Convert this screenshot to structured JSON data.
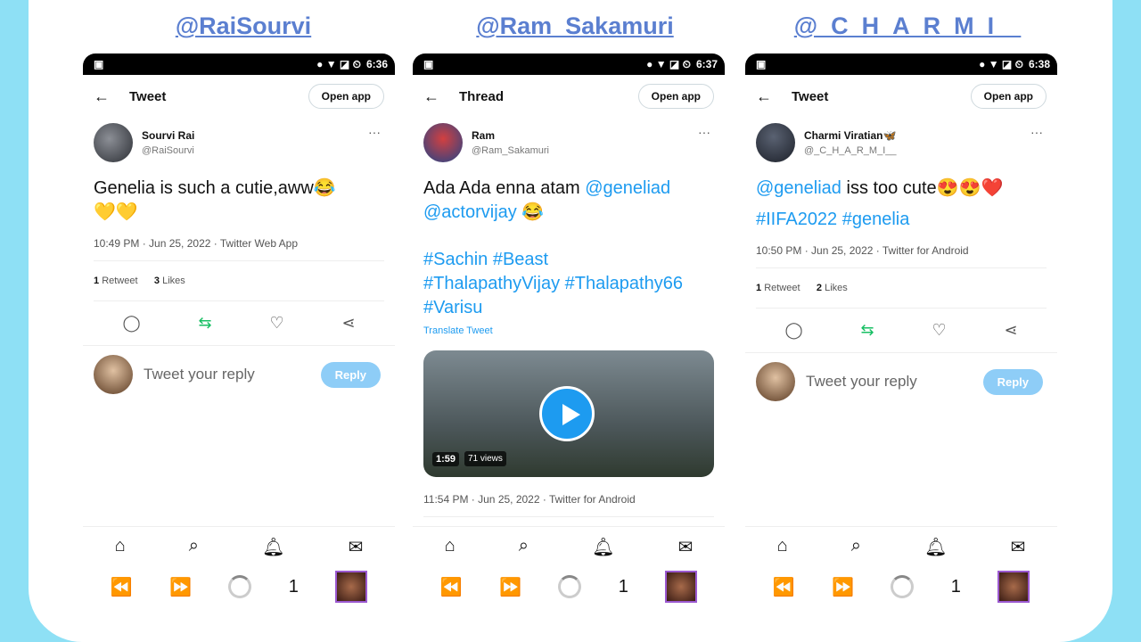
{
  "handles": [
    "@RaiSourvi",
    "@Ram_Sakamuri",
    "@_C_H_A_R_M_I__"
  ],
  "statusbar": [
    {
      "time": "6:36"
    },
    {
      "time": "6:37"
    },
    {
      "time": "6:38"
    }
  ],
  "phones": [
    {
      "header_title": "Tweet",
      "open_app": "Open app",
      "author_name": "Sourvi Rai",
      "author_handle": "@RaiSourvi",
      "text": "Genelia is such a cutie,aww😂",
      "text2": "💛💛",
      "meta": "10:49 PM · Jun 25, 2022 · Twitter Web App",
      "retweets_num": "1",
      "retweets_label": "Retweet",
      "likes_num": "3",
      "likes_label": "Likes",
      "reply_placeholder": "Tweet your reply",
      "reply_button": "Reply"
    },
    {
      "header_title": "Thread",
      "open_app": "Open app",
      "author_name": "Ram",
      "author_handle": "@Ram_Sakamuri",
      "text_part1": "Ada Ada enna atam ",
      "mention1": "@geneliad",
      "mention2": "@actorvijay",
      "text_emoji": " 😂",
      "hashtags1": "#Sachin #Beast",
      "hashtags2": "#ThalapathyVijay #Thalapathy66",
      "hashtags3": "#Varisu",
      "translate": "Translate Tweet",
      "video_duration": "1:59",
      "video_views": "71 views",
      "meta": "11:54 PM · Jun 25, 2022 · Twitter for Android"
    },
    {
      "header_title": "Tweet",
      "open_app": "Open app",
      "author_name": "Charmi Viratian🦋",
      "author_handle": "@_C_H_A_R_M_I__",
      "mention": "@geneliad",
      "text": "  iss too cute😍😍❤️",
      "hashtags": "#IIFA2022 #genelia",
      "meta": "10:50 PM · Jun 25, 2022 · Twitter for Android",
      "retweets_num": "1",
      "retweets_label": "Retweet",
      "likes_num": "2",
      "likes_label": "Likes",
      "reply_placeholder": "Tweet your reply",
      "reply_button": "Reply"
    }
  ],
  "browser": {
    "tab_count": "1"
  },
  "icons": {
    "back": "arrow-left-icon",
    "reply": "comment-icon",
    "retweet": "retweet-icon",
    "like": "heart-icon",
    "share": "share-icon",
    "home": "home-icon",
    "search": "search-icon",
    "bell": "bell-icon",
    "mail": "mail-icon"
  },
  "colors": {
    "background": "#8ee0f5",
    "handle": "#5b7fd0",
    "link": "#1d9bf0",
    "retweet": "#17bf63",
    "reply_button": "#8ecdf7"
  }
}
